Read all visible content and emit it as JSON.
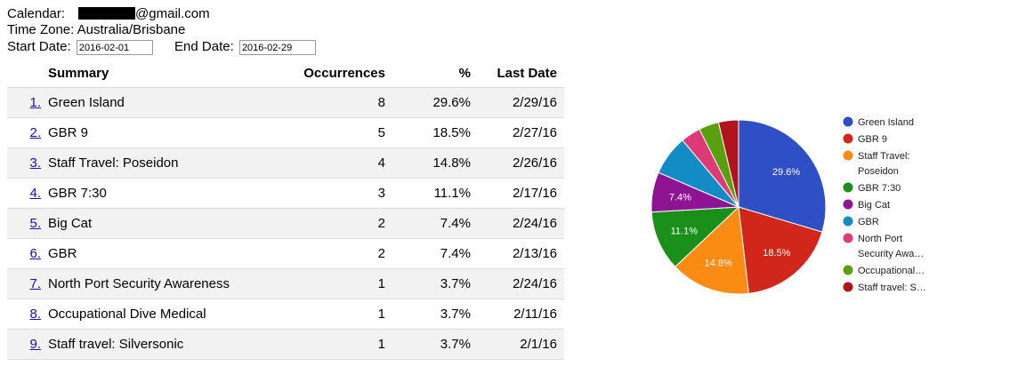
{
  "header": {
    "calendar_label": "Calendar:",
    "calendar_value": "@gmail.com",
    "timezone_text": "Time Zone: Australia/Brisbane",
    "start_label": "Start Date:",
    "start_value": "2016-02-01",
    "end_label": "End Date:",
    "end_value": "2016-02-29"
  },
  "table": {
    "headers": [
      "Summary",
      "Occurrences",
      "%",
      "Last Date"
    ],
    "rows": [
      {
        "num": "1.",
        "summary": "Green Island",
        "occurrences": "8",
        "percent": "29.6%",
        "last": "2/29/16"
      },
      {
        "num": "2.",
        "summary": "GBR 9",
        "occurrences": "5",
        "percent": "18.5%",
        "last": "2/27/16"
      },
      {
        "num": "3.",
        "summary": "Staff Travel: Poseidon",
        "occurrences": "4",
        "percent": "14.8%",
        "last": "2/26/16"
      },
      {
        "num": "4.",
        "summary": "GBR 7:30",
        "occurrences": "3",
        "percent": "11.1%",
        "last": "2/17/16"
      },
      {
        "num": "5.",
        "summary": "Big Cat",
        "occurrences": "2",
        "percent": "7.4%",
        "last": "2/24/16"
      },
      {
        "num": "6.",
        "summary": "GBR",
        "occurrences": "2",
        "percent": "7.4%",
        "last": "2/13/16"
      },
      {
        "num": "7.",
        "summary": "North Port Security Awareness",
        "occurrences": "1",
        "percent": "3.7%",
        "last": "2/24/16"
      },
      {
        "num": "8.",
        "summary": "Occupational Dive Medical",
        "occurrences": "1",
        "percent": "3.7%",
        "last": "2/11/16"
      },
      {
        "num": "9.",
        "summary": "Staff travel: Silversonic",
        "occurrences": "1",
        "percent": "3.7%",
        "last": "2/1/16"
      }
    ]
  },
  "chart_data": {
    "type": "pie",
    "legend_position": "right",
    "slices": [
      {
        "label": "Green Island",
        "legend_lines": [
          "Green Island"
        ],
        "value": 8,
        "percent_label": "29.6%",
        "color": "#2e4fc6"
      },
      {
        "label": "GBR 9",
        "legend_lines": [
          "GBR 9"
        ],
        "value": 5,
        "percent_label": "18.5%",
        "color": "#d1271a"
      },
      {
        "label": "Staff Travel: Poseidon",
        "legend_lines": [
          "Staff Travel:",
          "Poseidon"
        ],
        "value": 4,
        "percent_label": "14.8%",
        "color": "#fb8c13"
      },
      {
        "label": "GBR 7:30",
        "legend_lines": [
          "GBR 7:30"
        ],
        "value": 3,
        "percent_label": "11.1%",
        "color": "#1a8f1a"
      },
      {
        "label": "Big Cat",
        "legend_lines": [
          "Big Cat"
        ],
        "value": 2,
        "percent_label": "7.4%",
        "color": "#8f1494"
      },
      {
        "label": "GBR",
        "legend_lines": [
          "GBR"
        ],
        "value": 2,
        "percent_label": "",
        "color": "#138cc5"
      },
      {
        "label": "North Port Security Awareness",
        "legend_lines": [
          "North Port",
          "Security Awa…"
        ],
        "value": 1,
        "percent_label": "",
        "color": "#de3a78"
      },
      {
        "label": "Occupational Dive Medical",
        "legend_lines": [
          "Occupational…"
        ],
        "value": 1,
        "percent_label": "",
        "color": "#5aa00c"
      },
      {
        "label": "Staff travel: Silversonic",
        "legend_lines": [
          "Staff travel: S…"
        ],
        "value": 1,
        "percent_label": "",
        "color": "#b0141c"
      }
    ]
  }
}
